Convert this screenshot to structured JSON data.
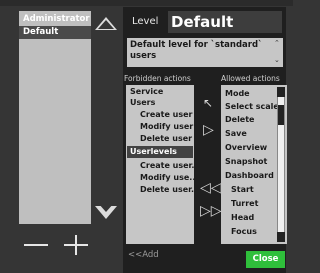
{
  "roles": {
    "items": [
      "Administrator",
      "Default"
    ],
    "selected": "Default"
  },
  "level": {
    "label": "Level",
    "name": "Default",
    "description": "Default level for `standard` users"
  },
  "forbidden": {
    "header": "Forbidden actions",
    "items": [
      "Service",
      "Users",
      "Create user",
      "Modify user",
      "Delete user",
      "Userlevels",
      "Create user...",
      "Modify use...",
      "Delete user..."
    ]
  },
  "allowed": {
    "header": "Allowed actions",
    "items": [
      "Mode",
      "Select scale",
      "Delete",
      "Save",
      "Overview",
      "Snapshot",
      "Dashboard",
      "Start",
      "Turret",
      "Head",
      "Focus"
    ]
  },
  "buttons": {
    "add": "<<Add",
    "close": "Close"
  },
  "colors": {
    "close_bg": "#2fbf3b",
    "selected_bg": "#424242",
    "list_bg": "#c6c6c6"
  }
}
